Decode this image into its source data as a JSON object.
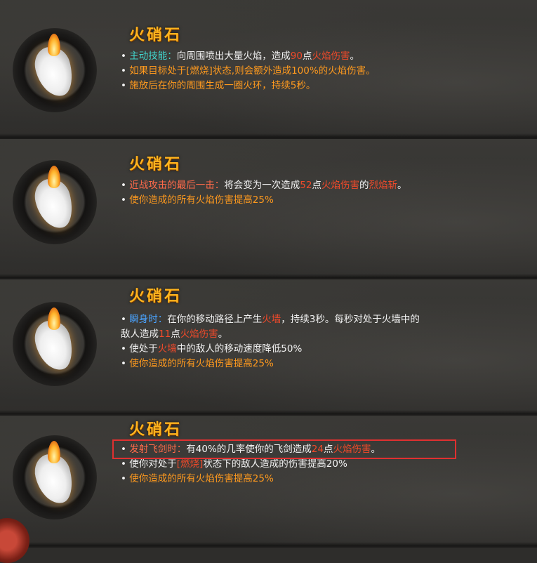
{
  "colors": {
    "title": "#ffb41e",
    "text": "#f2f2f2",
    "orange": "#ff9a1e",
    "red": "#f04a2a",
    "cyan": "#41d7cf",
    "blue": "#4aa3ff",
    "highlight_box": "#e03030"
  },
  "cards": [
    {
      "icon": "fire-stone-icon",
      "title": "火硝石",
      "l1": {
        "bullet": "•",
        "key": "主动技能",
        "colon": "：",
        "a": "向周围喷出大量火焰，造成",
        "num": "90",
        "b": "点",
        "dmg": "火焰伤害",
        "end": "。"
      },
      "l2": {
        "bullet": "•",
        "text": "如果目标处于[燃烧]状态,则会额外造成100%的火焰伤害。"
      },
      "l3": {
        "bullet": "•",
        "text": "施放后在你的周围生成一圈火环，持续5秒。"
      }
    },
    {
      "icon": "fire-stone-icon",
      "title": "火硝石",
      "l1": {
        "bullet": "•",
        "key": "近战攻击的最后一击",
        "colon": "：",
        "a": "将会变为一次造成",
        "num": "52",
        "b": "点",
        "dmg": "火焰伤害",
        "c": "的",
        "skill": "烈焰斩",
        "end": "。"
      },
      "l2": {
        "bullet": "•",
        "text": "使你造成的所有火焰伤害提高25%"
      }
    },
    {
      "icon": "fire-stone-icon",
      "title": "火硝石",
      "l1": {
        "bullet": "•",
        "key": "瞬身时",
        "colon": "：",
        "a": "在你的移动路径上产生",
        "wall": "火墙",
        "b": "，持续3秒。每秒对处于火墙中的"
      },
      "l1b": {
        "a": "敌人造成",
        "num": "11",
        "b": "点",
        "dmg": "火焰伤害",
        "end": "。"
      },
      "l2": {
        "bullet": "•",
        "a": "使处于",
        "wall": "火墙",
        "b": "中的敌人的移动速度降低50%"
      },
      "l3": {
        "bullet": "•",
        "text": "使你造成的所有火焰伤害提高25%"
      }
    },
    {
      "icon": "fire-stone-icon",
      "title": "火硝石",
      "l1": {
        "bullet": "•",
        "key": "发射飞剑时",
        "colon": "：",
        "a": "有40%的几率使你的飞剑造成",
        "num": "24",
        "b": "点",
        "dmg": "火焰伤害",
        "end": "。"
      },
      "l2": {
        "bullet": "•",
        "a": "使你对处于",
        "status": "[燃烧]",
        "b": "状态下的敌人造成的伤害提高20%"
      },
      "l3": {
        "bullet": "•",
        "text": "使你造成的所有火焰伤害提高25%"
      }
    }
  ]
}
